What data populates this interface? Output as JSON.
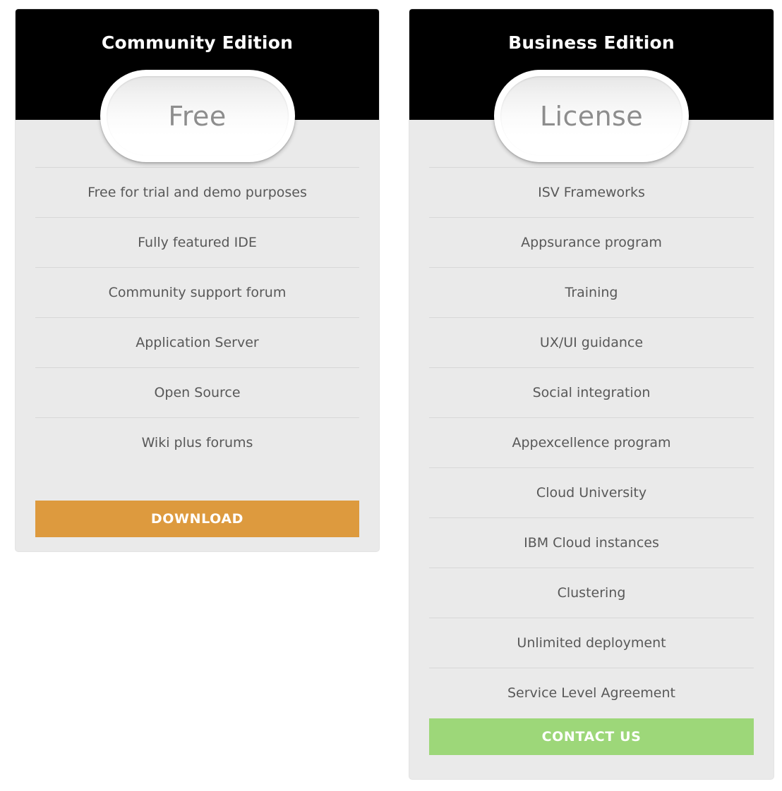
{
  "page": {
    "background_color": "#ffffff"
  },
  "plans": [
    {
      "id": "community",
      "title": "Community Edition",
      "price_label": "Free",
      "header_background": "#000000",
      "body_background": "#eaeaea",
      "features": [
        "Free for trial and demo purposes",
        "Fully featured IDE",
        "Community support forum",
        "Application Server",
        "Open Source",
        "Wiki plus forums"
      ],
      "cta": {
        "label": "DOWNLOAD",
        "color": "#dd9a3e"
      }
    },
    {
      "id": "business",
      "title": "Business Edition",
      "price_label": "License",
      "header_background": "#000000",
      "body_background": "#eaeaea",
      "features": [
        "ISV Frameworks",
        "Appsurance program",
        "Training",
        "UX/UI guidance",
        "Social integration",
        "Appexcellence program",
        "Cloud University",
        "IBM Cloud instances",
        "Clustering",
        "Unlimited deployment",
        "Service Level Agreement"
      ],
      "cta": {
        "label": "CONTACT US",
        "color": "#9dd779"
      }
    }
  ]
}
